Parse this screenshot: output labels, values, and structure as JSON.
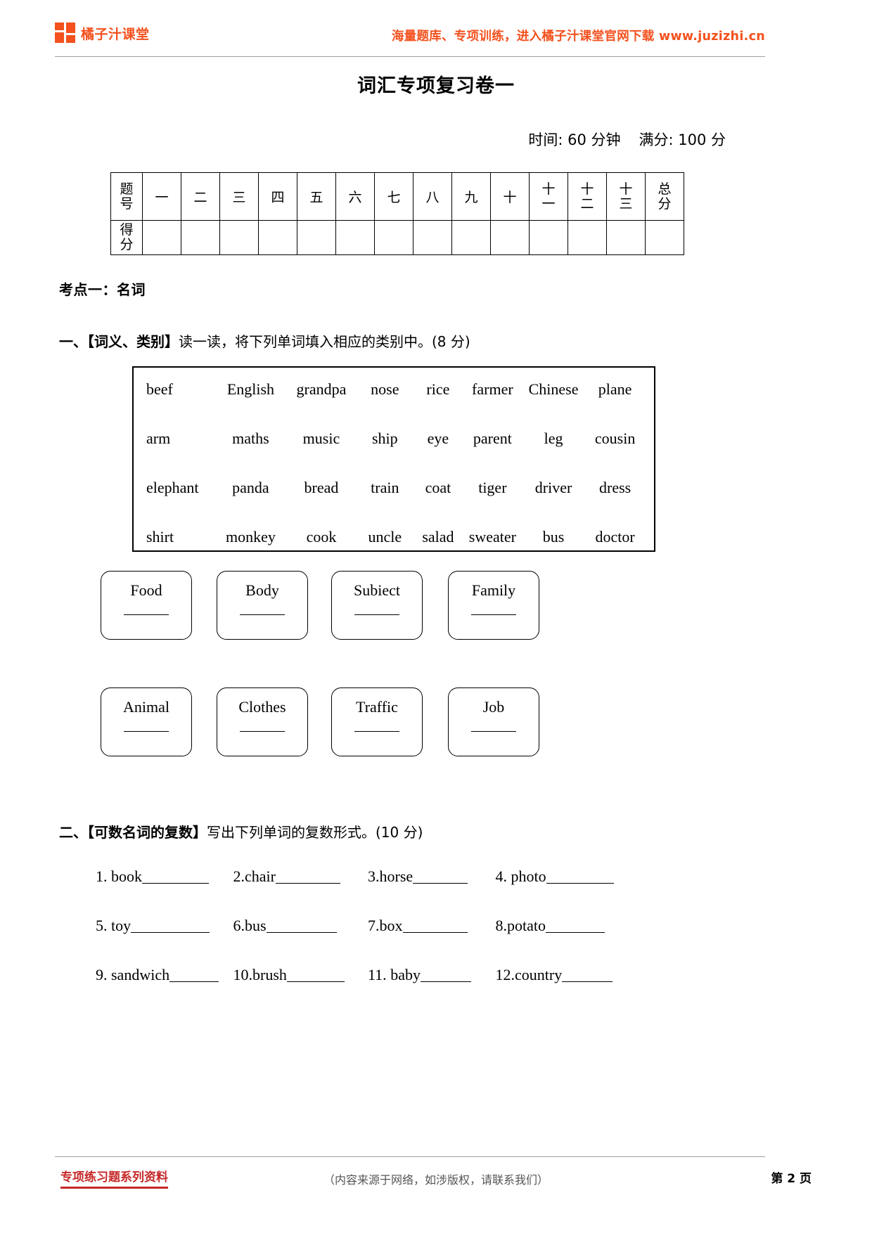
{
  "header": {
    "logo_text": "橘子汁课堂",
    "logo_icon": "four-squares-logo-icon",
    "slogan": "海量题库、专项训练，进入橘子汁课堂官网下载 www.juzizhi.cn",
    "accent_color": "#f4511e"
  },
  "title": "词汇专项复习卷一",
  "meta": {
    "time": "时间: 60 分钟",
    "total": "满分: 100 分"
  },
  "score_table": {
    "row1_label": "题号",
    "row2_label": "得分",
    "columns": [
      "一",
      "二",
      "三",
      "四",
      "五",
      "六",
      "七",
      "八",
      "九",
      "十",
      "十一",
      "十二",
      "十三",
      "总分"
    ],
    "column_stacks": [
      [
        "一"
      ],
      [
        "二"
      ],
      [
        "三"
      ],
      [
        "四"
      ],
      [
        "五"
      ],
      [
        "六"
      ],
      [
        "七"
      ],
      [
        "八"
      ],
      [
        "九"
      ],
      [
        "十"
      ],
      [
        "十",
        "一"
      ],
      [
        "十",
        "二"
      ],
      [
        "十",
        "三"
      ],
      [
        "总",
        "分"
      ]
    ],
    "answers": [
      "",
      "",
      "",
      "",
      "",
      "",
      "",
      "",
      "",
      "",
      "",
      "",
      "",
      ""
    ]
  },
  "knowledge_point": "考点一：名词",
  "q1": {
    "index": "一、",
    "tag": "【词义、类别】",
    "text": "读一读，将下列单词填入相应的类别中。",
    "score": "(8 分)",
    "word_bank": [
      [
        "beef",
        "English",
        "grandpa",
        "nose",
        "rice",
        "farmer",
        "Chinese",
        "plane"
      ],
      [
        "arm",
        "maths",
        "music",
        "ship",
        "eye",
        "parent",
        "leg",
        "cousin"
      ],
      [
        "elephant",
        "panda",
        "bread",
        "train",
        "coat",
        "tiger",
        "driver",
        "dress"
      ],
      [
        "shirt",
        "monkey",
        "cook",
        "uncle",
        "salad",
        "sweater",
        "bus",
        "doctor"
      ]
    ],
    "categories": [
      "Food",
      "Body",
      "Subiect",
      "Family",
      "Animal",
      "Clothes",
      "Traffic",
      "Job"
    ]
  },
  "q2": {
    "index": "二、",
    "tag": "【可数名词的复数】",
    "text": "写出下列单词的复数形式。",
    "score": "(10 分)",
    "rows": [
      [
        {
          "num": "1.",
          "word": "book",
          "blank_width": 95
        },
        {
          "num": "2.",
          "word": "chair",
          "blank_width": 92
        },
        {
          "num": "3.",
          "word": "horse",
          "blank_width": 78
        },
        {
          "num": "4.",
          "word": "photo",
          "blank_width": 96
        }
      ],
      [
        {
          "num": "5.",
          "word": "toy",
          "blank_width": 112
        },
        {
          "num": "6.",
          "word": "bus",
          "blank_width": 100
        },
        {
          "num": "7.",
          "word": "box",
          "blank_width": 92
        },
        {
          "num": "8.",
          "word": "potato",
          "blank_width": 84
        }
      ],
      [
        {
          "num": "9.",
          "word": "sandwich",
          "blank_width": 70
        },
        {
          "num": "10.",
          "word": "brush",
          "blank_width": 82
        },
        {
          "num": "11.",
          "word": "baby",
          "blank_width": 72
        },
        {
          "num": "12.",
          "word": "country",
          "blank_width": 72
        }
      ]
    ]
  },
  "footer": {
    "left": "专项练习题系列资料",
    "center": "（内容来源于网络，如涉版权，请联系我们）",
    "page": "第 2 页",
    "left_color": "#c62828"
  }
}
